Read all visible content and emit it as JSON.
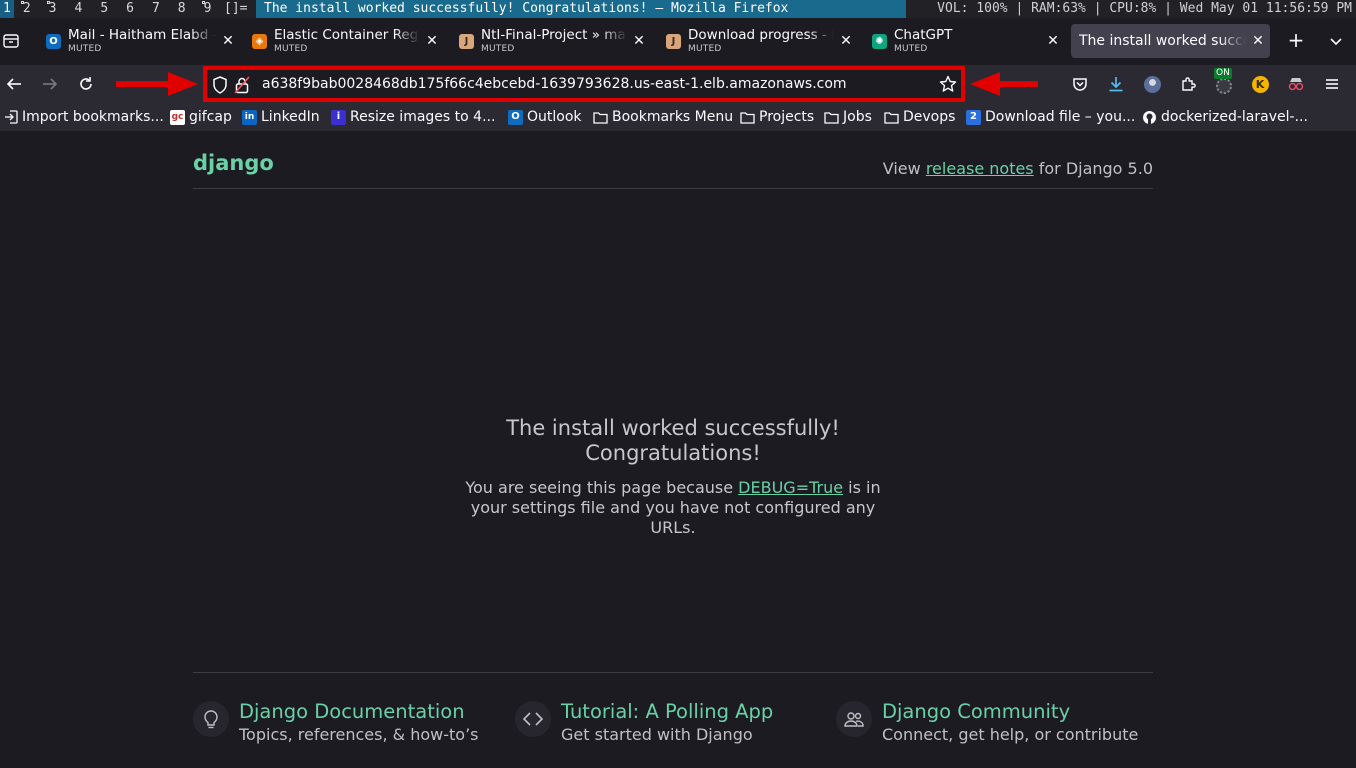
{
  "wm": {
    "workspaces": [
      "1",
      "2",
      "3",
      "4",
      "5",
      "6",
      "7",
      "8",
      "9"
    ],
    "layout": "[]=",
    "window_title": "The install worked successfully! Congratulations! — Mozilla Firefox",
    "status": "VOL: 100% | RAM:63%  |  CPU:8% |  Wed May 01 11:56:59 PM"
  },
  "tabs": [
    {
      "title": "Mail - Haitham Elabd -",
      "sub": "MUTED",
      "favicon": "outlook-icon",
      "color": "#0f6cbd",
      "glyph": "O"
    },
    {
      "title": "Elastic Container Regi",
      "sub": "MUTED",
      "favicon": "aws-ecr-icon",
      "color": "#e8780c",
      "glyph": "◈"
    },
    {
      "title": "NtI-Final-Project » mas",
      "sub": "MUTED",
      "favicon": "jenkins-icon",
      "color": "#d9a57a",
      "glyph": "J"
    },
    {
      "title": "Download progress - P",
      "sub": "MUTED",
      "favicon": "jenkins-icon",
      "color": "#d9a57a",
      "glyph": "J"
    },
    {
      "title": "ChatGPT",
      "sub": "MUTED",
      "favicon": "chatgpt-icon",
      "color": "#10a37f",
      "glyph": "✺"
    },
    {
      "title": "The install worked succes",
      "sub": "",
      "favicon": "",
      "color": "",
      "glyph": ""
    }
  ],
  "navbar": {
    "url": "a638f9bab0028468db175f66c4ebcebd-1639793628.us-east-1.elb.amazonaws.com",
    "ext_badge": "ON"
  },
  "bookmarks": [
    {
      "label": "Import bookmarks...",
      "icon": "import-icon"
    },
    {
      "label": "gifcap",
      "icon": "gifcap-icon",
      "glyph": "gc"
    },
    {
      "label": "LinkedIn",
      "icon": "linkedin-icon",
      "glyph": "in"
    },
    {
      "label": "Resize images to 4...",
      "icon": "resize-icon",
      "glyph": "i"
    },
    {
      "label": "Outlook",
      "icon": "outlook-icon",
      "glyph": "O"
    },
    {
      "label": "Bookmarks Menu",
      "icon": "folder-icon"
    },
    {
      "label": "Projects",
      "icon": "folder-icon"
    },
    {
      "label": "Jobs",
      "icon": "folder-icon"
    },
    {
      "label": "Devops",
      "icon": "folder-icon"
    },
    {
      "label": "Download file – you...",
      "icon": "download-file-icon",
      "glyph": "2"
    },
    {
      "label": "dockerized-laravel-...",
      "icon": "github-icon"
    }
  ],
  "page": {
    "logo": "django",
    "release_prefix": "View ",
    "release_link": "release notes",
    "release_suffix": " for Django 5.0",
    "hero_line1": "The install worked successfully!",
    "hero_line2": "Congratulations!",
    "text_before": "You are seeing this page because ",
    "debug_link": "DEBUG=True",
    "text_after": " is in your settings file and you have not configured any URLs.",
    "footer": [
      {
        "title": "Django Documentation",
        "sub": "Topics, references, & how-to’s",
        "icon": "lightbulb-icon"
      },
      {
        "title": "Tutorial: A Polling App",
        "sub": "Get started with Django",
        "icon": "code-icon"
      },
      {
        "title": "Django Community",
        "sub": "Connect, get help, or contribute",
        "icon": "people-icon"
      }
    ]
  },
  "colors": {
    "accent_green": "#6ad0a6",
    "highlight_red": "#e00000",
    "wm_title_bg": "#1a6a8e"
  }
}
